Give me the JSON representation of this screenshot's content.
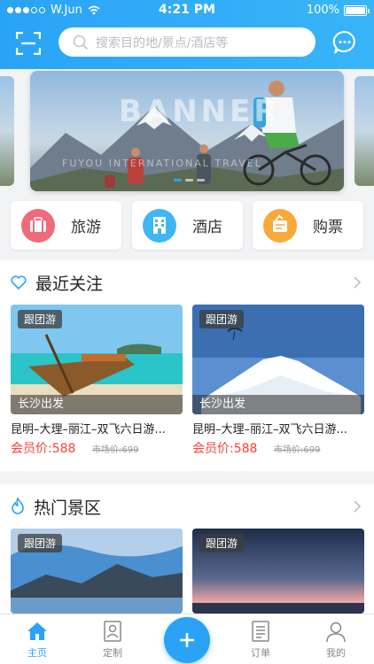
{
  "status_bar": {
    "carrier": "W.Jun",
    "time": "4:21 PM",
    "battery": "100%"
  },
  "search": {
    "placeholder": "搜索目的地/景点/酒店等"
  },
  "banner": {
    "title": "BANNER",
    "subtitle": "FUYOU INTERNATIONAL TRAVEL"
  },
  "categories": [
    {
      "label": "旅游",
      "icon": "suitcase-icon",
      "color": "#f06b7a"
    },
    {
      "label": "酒店",
      "icon": "hotel-building-icon",
      "color": "#3eb6f3"
    },
    {
      "label": "购票",
      "icon": "ticket-icon",
      "color": "#f7a93a"
    }
  ],
  "recent": {
    "title": "最近关注",
    "cards": [
      {
        "tag": "跟团游",
        "depart": "长沙出发",
        "name": "昆明–大理–丽江–双飞六日游...",
        "price": "会员价:588",
        "market_price": "市场价:699"
      },
      {
        "tag": "跟团游",
        "depart": "长沙出发",
        "name": "昆明–大理–丽江–双飞六日游...",
        "price": "会员价:588",
        "market_price": "市场价:699"
      }
    ]
  },
  "hot": {
    "title": "热门景区",
    "cards": [
      {
        "tag": "跟团游"
      },
      {
        "tag": "跟团游"
      }
    ]
  },
  "tabbar": {
    "items": [
      {
        "label": "主页",
        "active": true
      },
      {
        "label": "定制",
        "active": false
      },
      {
        "label": "订单",
        "active": false
      },
      {
        "label": "我的",
        "active": false
      }
    ]
  },
  "colors": {
    "accent": "#2aa3f7",
    "price": "#f44336"
  }
}
